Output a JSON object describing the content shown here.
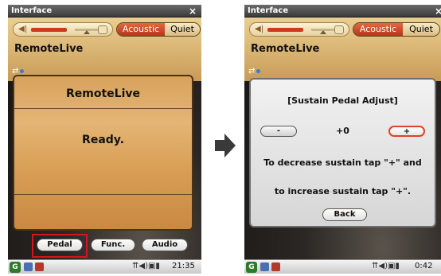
{
  "left": {
    "window_title": "Interface",
    "close": "×",
    "mode_active": "Acoustic",
    "mode_inactive": "Quiet",
    "app_name": "RemoteLive",
    "volume_level": 0.45,
    "panel_title": "RemoteLive",
    "status": "Ready.",
    "buttons": {
      "pedal": "Pedal",
      "func": "Func.",
      "audio": "Audio"
    },
    "clock": "21:35"
  },
  "right": {
    "window_title": "Interface",
    "close": "×",
    "mode_active": "Acoustic",
    "mode_inactive": "Quiet",
    "app_name": "RemoteLive",
    "dialog_title": "[Sustain Pedal Adjust]",
    "minus": "-",
    "value": "+0",
    "plus": "+",
    "line1": "To decrease sustain tap \"+\" and",
    "line2": "to increase sustain tap \"+\".",
    "back": "Back",
    "clock": "0:42"
  },
  "colors": {
    "accent": "#d4151c",
    "gold": "#dcb877",
    "arrow": "#3a3a3a"
  },
  "icons": [
    "close-icon",
    "speaker-icon",
    "link-icon",
    "start-icon",
    "signal-icon",
    "speaker-tray-icon",
    "battery-icon",
    "arrow-right-icon"
  ]
}
